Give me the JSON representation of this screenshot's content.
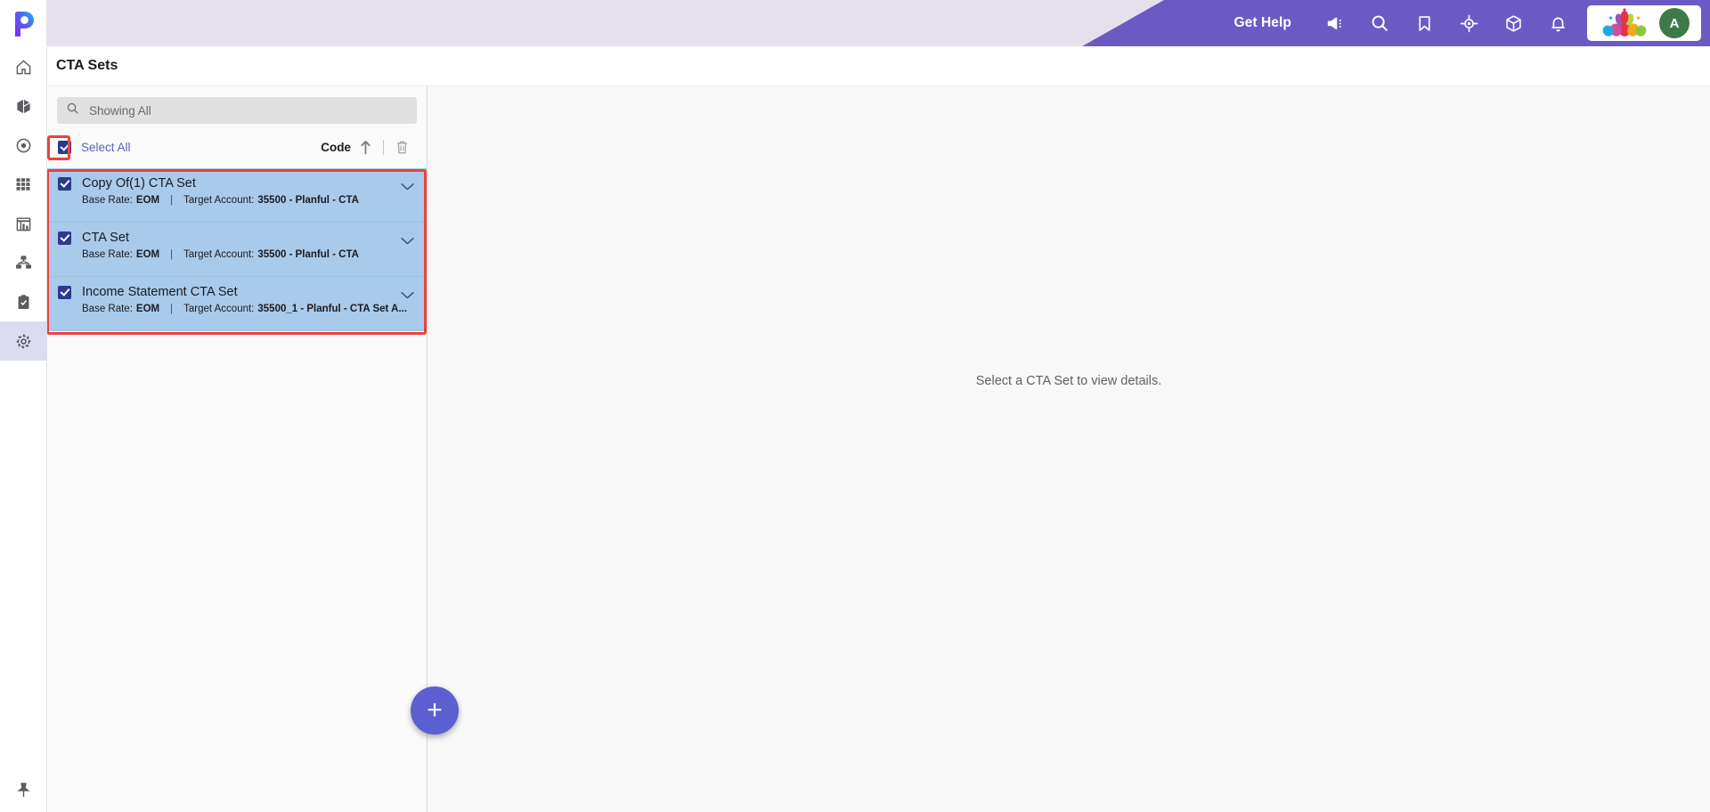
{
  "header": {
    "get_help_label": "Get Help",
    "purple_hex": "#6c5ac4",
    "bar_hex": "#e5e0ec",
    "avatar_initial": "A",
    "icons": [
      {
        "name": "announcement-icon",
        "label": "Announcements"
      },
      {
        "name": "search-icon",
        "label": "Search"
      },
      {
        "name": "bookmark-icon",
        "label": "Bookmarks"
      },
      {
        "name": "target-icon",
        "label": "Target"
      },
      {
        "name": "package-icon",
        "label": "Package"
      },
      {
        "name": "bell-icon",
        "label": "Notifications"
      }
    ]
  },
  "sidebar": {
    "logo_name": "planful-logo",
    "items": [
      {
        "name": "sidebar-item-home",
        "label": "Home",
        "icon": "home-icon",
        "active": false
      },
      {
        "name": "sidebar-item-cube",
        "label": "Modeling",
        "icon": "cube-icon",
        "active": false
      },
      {
        "name": "sidebar-item-target",
        "label": "Target",
        "icon": "circle-dot-icon",
        "active": false
      },
      {
        "name": "sidebar-item-grid",
        "label": "Grid",
        "icon": "grid-icon",
        "active": false
      },
      {
        "name": "sidebar-item-reports",
        "label": "Reports",
        "icon": "bar-chart-icon",
        "active": false
      },
      {
        "name": "sidebar-item-hierarchy",
        "label": "Hierarchy",
        "icon": "hierarchy-icon",
        "active": false
      },
      {
        "name": "sidebar-item-tasks",
        "label": "Tasks",
        "icon": "clipboard-check-icon",
        "active": false
      },
      {
        "name": "sidebar-item-settings",
        "label": "Settings",
        "icon": "gear-icon",
        "active": true
      }
    ],
    "pin_label": "Pin navigation",
    "active_hex": "#dcdcf0"
  },
  "page": {
    "title": "CTA Sets"
  },
  "search": {
    "placeholder": "Showing All",
    "value": "Showing All",
    "icon": "search-icon"
  },
  "toolbar": {
    "select_all_label": "Select All",
    "select_all_checked": true,
    "sort_column_label": "Code",
    "sort_direction_icon": "arrow-up-icon",
    "delete_icon": "trash-icon"
  },
  "list": {
    "base_rate_prefix": "Base Rate:",
    "target_account_prefix": "Target Account:",
    "separator": "|",
    "selected_hex": "#a8cbeb",
    "items": [
      {
        "name": "Copy Of(1) CTA Set",
        "checked": true,
        "base_rate": "EOM",
        "target_account": "35500 - Planful - CTA"
      },
      {
        "name": "CTA Set",
        "checked": true,
        "base_rate": "EOM",
        "target_account": "35500 - Planful - CTA"
      },
      {
        "name": "Income Statement CTA Set",
        "checked": true,
        "base_rate": "EOM",
        "target_account": "35500_1 - Planful - CTA Set A..."
      }
    ]
  },
  "fab": {
    "label": "+",
    "name": "add-cta-set-button",
    "color": "#5c5fd1"
  },
  "detail": {
    "empty_message": "Select a CTA Set to view details."
  },
  "annotations": {
    "highlight_hex": "#f0403c",
    "boxes": [
      "select-all-checkbox-highlight",
      "cta-set-list-highlight"
    ]
  }
}
